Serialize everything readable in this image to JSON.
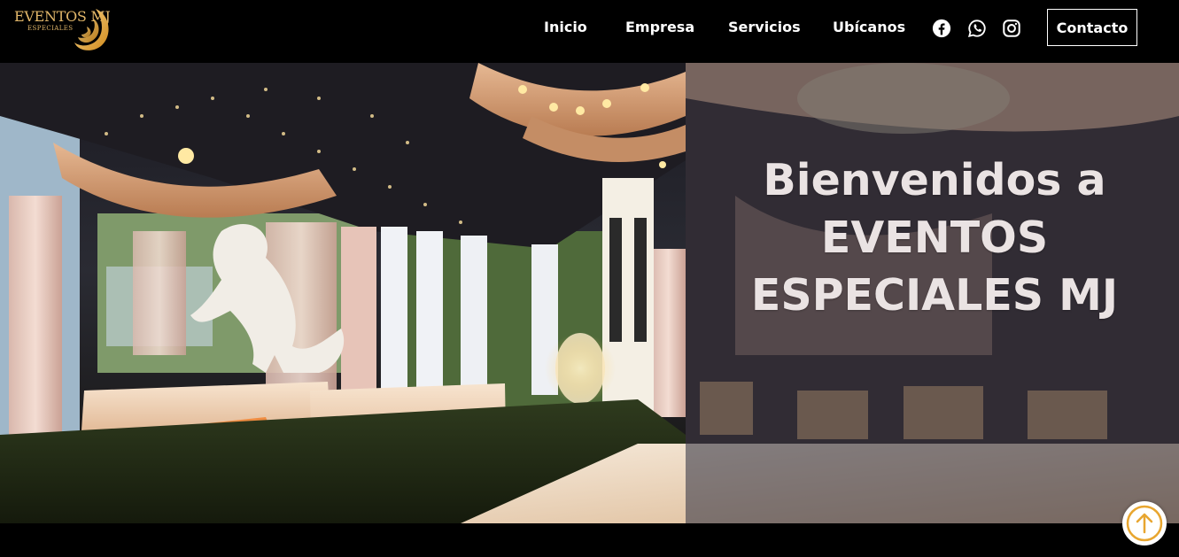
{
  "brand": {
    "logo_main": "EVENTOS MJ",
    "logo_sub": "ESPECIALES",
    "gold": "#e2b76a"
  },
  "nav": {
    "items": [
      {
        "label": "Inicio"
      },
      {
        "label": "Empresa"
      },
      {
        "label": "Servicios"
      },
      {
        "label": "Ubícanos"
      }
    ],
    "social_icons": [
      "facebook-icon",
      "whatsapp-icon",
      "instagram-icon"
    ],
    "contact_label": "Contacto"
  },
  "hero": {
    "title_line1": "Bienvenidos a",
    "title_line2": "EVENTOS",
    "title_line3": "ESPECIALES MJ",
    "image_description_icon": "event-venue-photo"
  },
  "scroll_top": {
    "icon": "arrow-up-icon",
    "accent": "#e8a630"
  }
}
